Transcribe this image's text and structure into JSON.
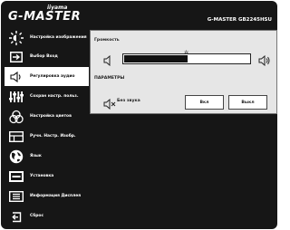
{
  "brand": "G-MASTER",
  "maker": "iiyama",
  "model": "G-MASTER GB2245HSU",
  "sidebar": {
    "items": [
      {
        "label": "Настройка изображения",
        "icon": "brightness-icon"
      },
      {
        "label": "Выбор Вход",
        "icon": "input-icon"
      },
      {
        "label": "Регулировка аудио",
        "icon": "speaker-icon"
      },
      {
        "label": "Сохран настр. польз.",
        "icon": "equalizer-icon"
      },
      {
        "label": "Настройка цветов",
        "icon": "color-circles-icon"
      },
      {
        "label": "Ручн. Настр. Изобр.",
        "icon": "picture-adjust-icon"
      },
      {
        "label": "Язык",
        "icon": "globe-icon"
      },
      {
        "label": "Установка",
        "icon": "setup-icon"
      },
      {
        "label": "Информация Дисплея",
        "icon": "info-icon"
      },
      {
        "label": "Сброс",
        "icon": "reset-icon"
      }
    ],
    "active_index": 2
  },
  "audio": {
    "volume_label": "Громкость",
    "volume_level": 0.5,
    "params_label": "ПАРАМЕТРЫ",
    "mute_label": "Без звука",
    "on_label": "Вкл",
    "off_label": "Выкл",
    "selected": "off"
  }
}
